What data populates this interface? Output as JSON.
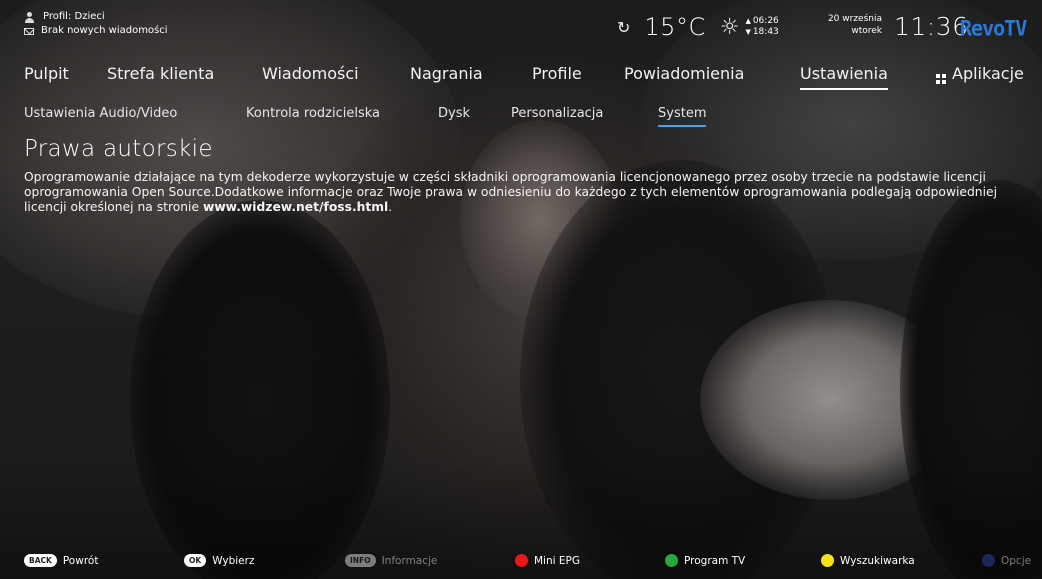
{
  "profile": {
    "name_line": "Profil: Dzieci",
    "messages_line": "Brak nowych wiadomości"
  },
  "weather": {
    "temperature": "15°C",
    "sunrise": "06:26",
    "sunset": "18:43"
  },
  "date": {
    "day_month": "20 września",
    "weekday": "wtorek"
  },
  "clock": "11:36",
  "logo": "RevoTV",
  "nav": {
    "items": [
      {
        "label": "Pulpit"
      },
      {
        "label": "Strefa klienta"
      },
      {
        "label": "Wiadomości"
      },
      {
        "label": "Nagrania"
      },
      {
        "label": "Profile"
      },
      {
        "label": "Powiadomienia"
      },
      {
        "label": "Ustawienia",
        "active": true
      },
      {
        "label": "Aplikacje"
      }
    ]
  },
  "subnav": {
    "items": [
      {
        "label": "Ustawienia Audio/Video"
      },
      {
        "label": "Kontrola rodzicielska"
      },
      {
        "label": "Dysk"
      },
      {
        "label": "Personalizacja"
      },
      {
        "label": "System",
        "active": true
      }
    ]
  },
  "content": {
    "title": "Prawa autorskie",
    "text": "Oprogramowanie działające na tym dekoderze wykorzystuje w części składniki oprogramowania licencjonowanego przez osoby trzecie na podstawie licencji oprogramowania Open Source.Dodatkowe informacje oraz Twoje prawa w odniesieniu do każdego z tych elementów oprogramowania podlegają odpowiedniej licencji określonej na stronie ",
    "link": "www.widzew.net/foss.html",
    "text_end": "."
  },
  "legend": {
    "back_key": "BACK",
    "back_label": "Powrót",
    "ok_key": "OK",
    "ok_label": "Wybierz",
    "info_key": "INFO",
    "info_label": "Informacje",
    "red_label": "Mini EPG",
    "green_label": "Program TV",
    "yellow_label": "Wyszukiwarka",
    "blue_label": "Opcje",
    "colors": {
      "red": "#e8191c",
      "green": "#27a83a",
      "yellow": "#f3e21a",
      "blue": "#2d4fb8"
    }
  },
  "colors": {
    "accent_underline": "#4aa3e8",
    "logo": "#2a78d6"
  }
}
